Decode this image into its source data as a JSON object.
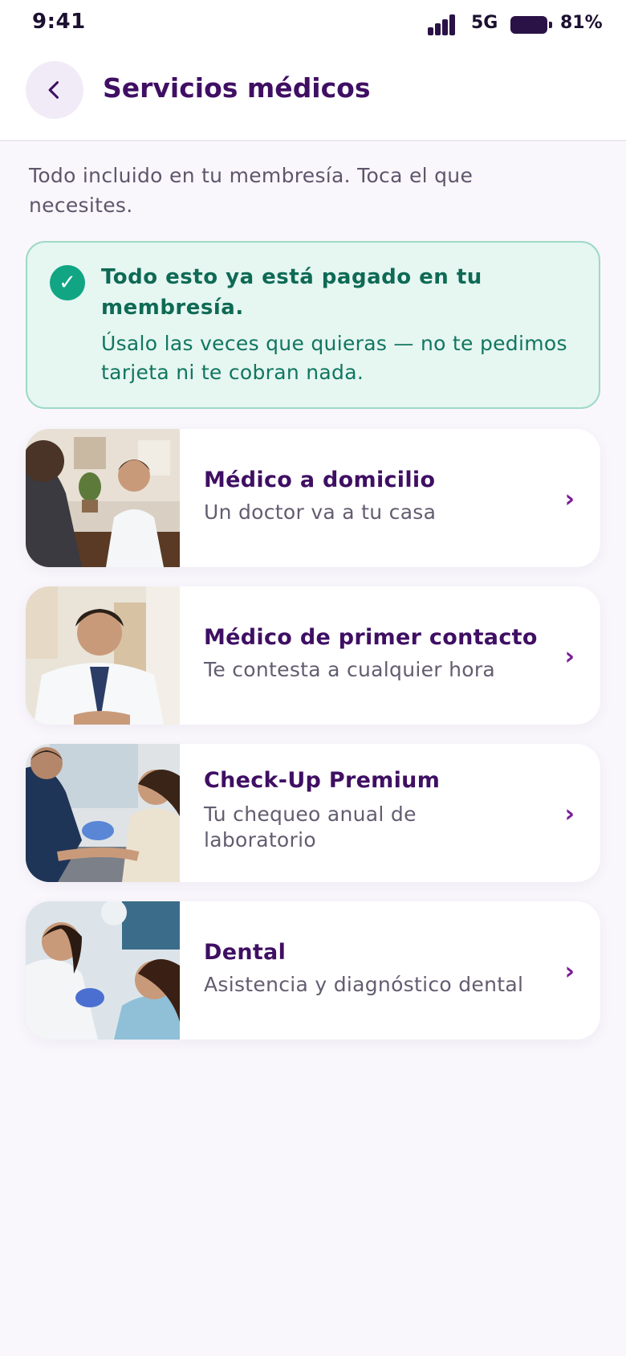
{
  "status_bar": {
    "time": "9:41",
    "network": "5G",
    "battery": "81%",
    "battery_level": 0.81
  },
  "header": {
    "back_icon": "chevron-left-icon",
    "title": "Servicios médicos"
  },
  "intro": "Todo incluido en tu membresía. Toca el que necesites.",
  "notice": {
    "icon": "check-circle-icon",
    "title": "Todo esto ya está pagado en tu membresía.",
    "body": "Úsalo las veces que quieras — no te pedimos tarjeta ni te cobran nada."
  },
  "services": [
    {
      "title": "Médico a domicilio",
      "subtitle": "Un doctor va a tu casa",
      "image": "doctor-consultation-photo"
    },
    {
      "title": "Médico de primer contacto",
      "subtitle": "Te contesta a cualquier hora",
      "image": "smiling-doctor-photo"
    },
    {
      "title": "Check-Up Premium",
      "subtitle": "Tu chequeo anual de laboratorio",
      "image": "blood-test-photo"
    },
    {
      "title": "Dental",
      "subtitle": "Asistencia y diagnóstico dental",
      "image": "dentist-photo"
    }
  ],
  "chevron_glyph": "›",
  "colors": {
    "primary": "#3f0f63",
    "accent": "#7a1a9a",
    "success": "#11a584",
    "notice_bg": "#e6f6f1"
  }
}
